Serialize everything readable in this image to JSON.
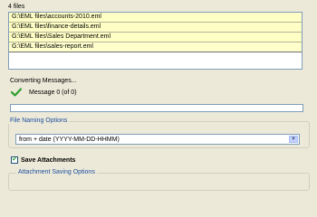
{
  "file_count_label": "4 files",
  "files": [
    "G:\\EML files\\accounts-2010.eml",
    "G:\\EML files\\finance-details.eml",
    "G:\\EML files\\Sales Department.eml",
    "G:\\EML files\\sales-report.eml"
  ],
  "status": {
    "converting_label": "Converting Messages...",
    "message_label": "Message 0 (of 0)",
    "progress_fraction": 0,
    "check_icon": "green-checkmark"
  },
  "file_naming": {
    "legend": "File Naming Options",
    "selected": "from + date (YYYY-MM-DD-HHMM)"
  },
  "attachments": {
    "save_label": "Save Attachments",
    "checked": true,
    "saving_options_legend": "Attachment Saving Options"
  },
  "colors": {
    "accent_legend": "#1e50a0",
    "check_green": "#2e9e2e",
    "list_highlight": "#ffffc5"
  }
}
